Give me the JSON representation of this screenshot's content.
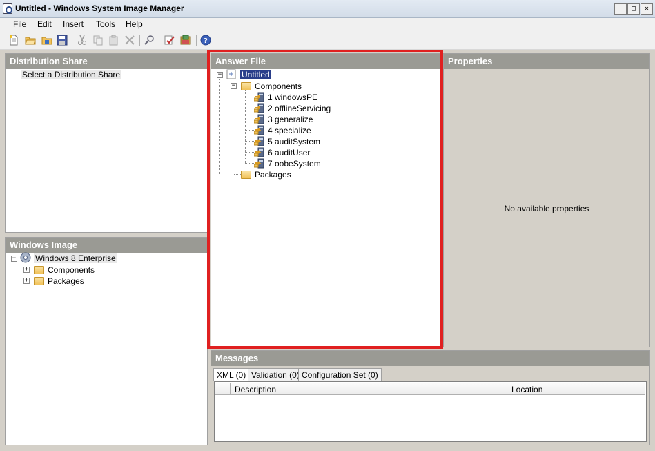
{
  "window": {
    "title": "Untitled - Windows System Image Manager",
    "buttons": {
      "minimize": "_",
      "maximize": "□",
      "close": "×"
    }
  },
  "menu": [
    "File",
    "Edit",
    "Insert",
    "Tools",
    "Help"
  ],
  "toolbar": {
    "icons": [
      "new-answer-file-icon",
      "open-answer-file-icon",
      "open-distribution-share-icon",
      "save-icon",
      "cut-icon",
      "copy-icon",
      "paste-icon",
      "delete-icon",
      "search-icon",
      "validate-icon",
      "create-configuration-set-icon",
      "help-icon"
    ]
  },
  "distribution_share": {
    "header": "Distribution Share",
    "item": "Select a Distribution Share"
  },
  "windows_image": {
    "header": "Windows Image",
    "root": "Windows 8 Enterprise",
    "children": [
      "Components",
      "Packages"
    ]
  },
  "answer_file": {
    "header": "Answer File",
    "root": "Untitled",
    "components_label": "Components",
    "passes": [
      "1 windowsPE",
      "2 offlineServicing",
      "3 generalize",
      "4 specialize",
      "5 auditSystem",
      "6 auditUser",
      "7 oobeSystem"
    ],
    "packages_label": "Packages",
    "highlight_color": "#e02020"
  },
  "properties": {
    "header": "Properties",
    "empty_text": "No available properties"
  },
  "messages": {
    "header": "Messages",
    "tabs": [
      "XML (0)",
      "Validation (0)",
      "Configuration Set (0)"
    ],
    "columns": [
      "Description",
      "Location"
    ]
  }
}
